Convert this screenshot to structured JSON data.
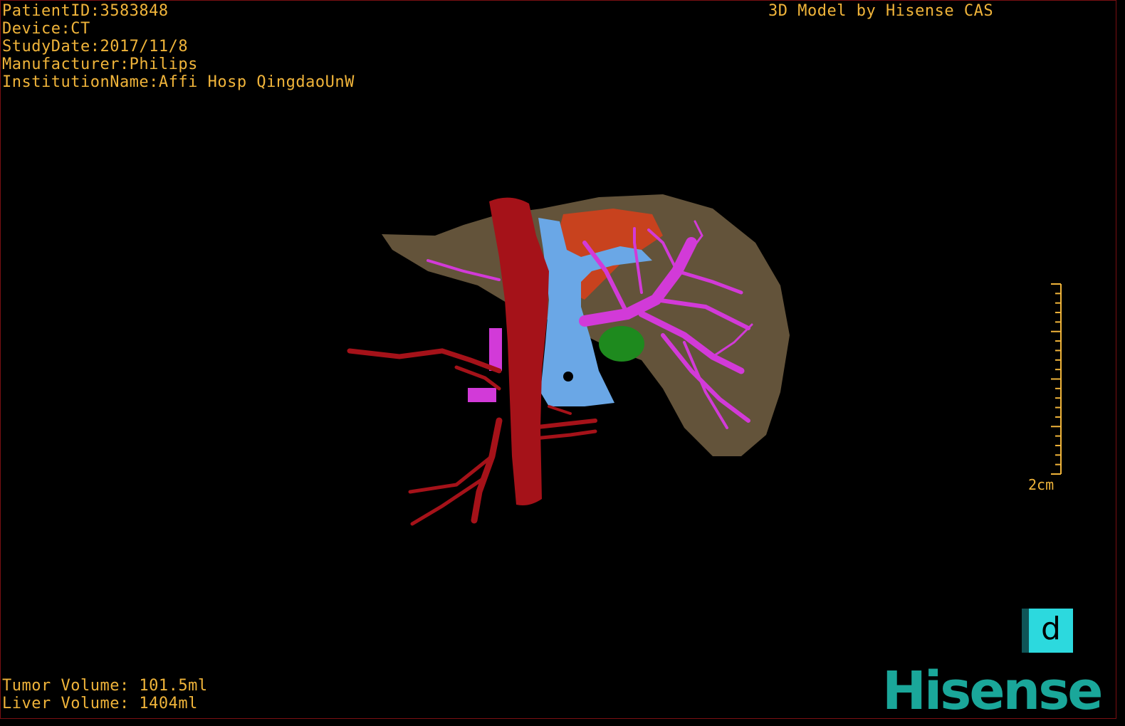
{
  "info": {
    "patient_id": "PatientID:3583848",
    "device": "Device:CT",
    "study_date": "StudyDate:2017/11/8",
    "manufacturer": "Manufacturer:Philips",
    "institution": "InstitutionName:Affi Hosp QingdaoUnW"
  },
  "credit": "3D Model by Hisense CAS",
  "volumes": {
    "tumor": "Tumor Volume: 101.5ml",
    "liver": "Liver Volume: 1404ml"
  },
  "scale_bar": {
    "label": "2cm"
  },
  "view_cube": {
    "face": "d"
  },
  "logo": {
    "text": "Hisense"
  },
  "colors": {
    "text": "#f0b43a",
    "liver": "#6b5a3f",
    "artery": "#b0141c",
    "vena_cava": "#6aa7e6",
    "portal_vein": "#d23ad8",
    "tumor": "#1e8a1e",
    "gallbladder": "#c8421e",
    "brand": "#1aa79a",
    "view_cube": "#2cd9de"
  },
  "icons": [
    "view-cube-icon",
    "hisense-logo"
  ]
}
